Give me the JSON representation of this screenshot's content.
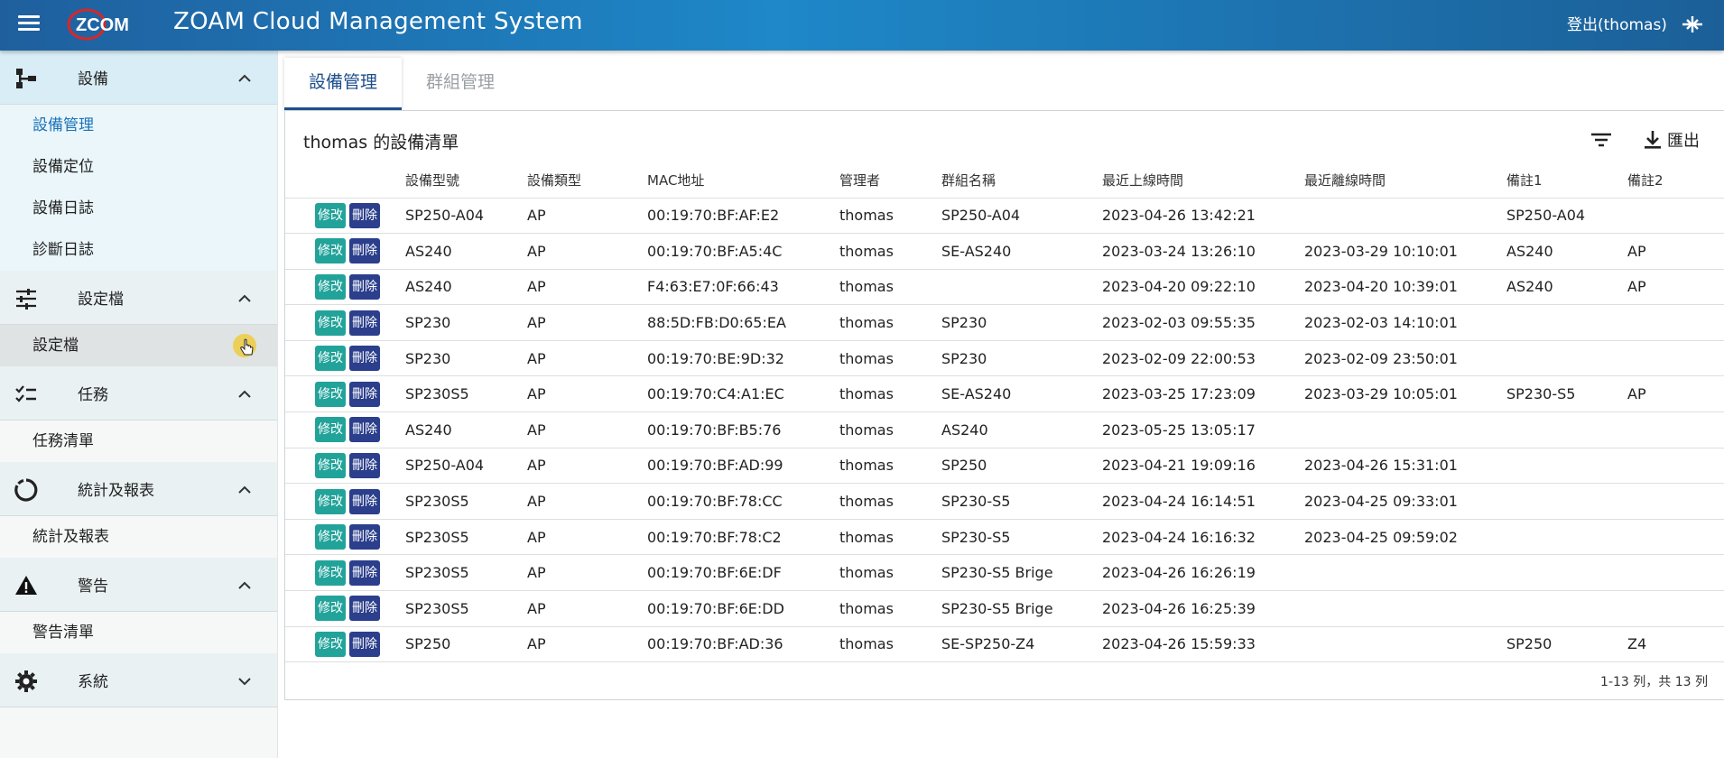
{
  "header": {
    "logo_text": "ZCOM",
    "title": "ZOAM Cloud Management System",
    "logout_label": "登出(thomas)"
  },
  "sidebar": {
    "sections": [
      {
        "label": "設備",
        "icon": "device-tree-icon",
        "expanded": true,
        "items": [
          "設備管理",
          "設備定位",
          "設備日誌",
          "診斷日誌"
        ]
      },
      {
        "label": "設定檔",
        "icon": "sliders-icon",
        "expanded": true,
        "items": [
          "設定檔"
        ]
      },
      {
        "label": "任務",
        "icon": "checklist-icon",
        "expanded": true,
        "items": [
          "任務清單"
        ]
      },
      {
        "label": "統計及報表",
        "icon": "donut-chart-icon",
        "expanded": true,
        "items": [
          "統計及報表"
        ]
      },
      {
        "label": "警告",
        "icon": "warning-icon",
        "expanded": true,
        "items": [
          "警告清單"
        ]
      },
      {
        "label": "系統",
        "icon": "gear-icon",
        "expanded": false,
        "items": []
      }
    ],
    "active_item": "設備管理"
  },
  "tabs": [
    {
      "label": "設備管理",
      "active": true
    },
    {
      "label": "群組管理",
      "active": false
    }
  ],
  "panel": {
    "title": "thomas 的設備清單",
    "export_label": "匯出",
    "edit_label": "修改",
    "delete_label": "刪除",
    "columns": [
      "設備型號",
      "設備類型",
      "MAC地址",
      "管理者",
      "群組名稱",
      "最近上線時間",
      "最近離線時間",
      "備註1",
      "備註2"
    ],
    "rows": [
      [
        "SP250-A04",
        "AP",
        "00:19:70:BF:AF:E2",
        "thomas",
        "SP250-A04",
        "2023-04-26 13:42:21",
        "",
        "SP250-A04",
        ""
      ],
      [
        "AS240",
        "AP",
        "00:19:70:BF:A5:4C",
        "thomas",
        "SE-AS240",
        "2023-03-24 13:26:10",
        "2023-03-29 10:10:01",
        "AS240",
        "AP"
      ],
      [
        "AS240",
        "AP",
        "F4:63:E7:0F:66:43",
        "thomas",
        "",
        "2023-04-20 09:22:10",
        "2023-04-20 10:39:01",
        "AS240",
        "AP"
      ],
      [
        "SP230",
        "AP",
        "88:5D:FB:D0:65:EA",
        "thomas",
        "SP230",
        "2023-02-03 09:55:35",
        "2023-02-03 14:10:01",
        "",
        ""
      ],
      [
        "SP230",
        "AP",
        "00:19:70:BE:9D:32",
        "thomas",
        "SP230",
        "2023-02-09 22:00:53",
        "2023-02-09 23:50:01",
        "",
        ""
      ],
      [
        "SP230S5",
        "AP",
        "00:19:70:C4:A1:EC",
        "thomas",
        "SE-AS240",
        "2023-03-25 17:23:09",
        "2023-03-29 10:05:01",
        "SP230-S5",
        "AP"
      ],
      [
        "AS240",
        "AP",
        "00:19:70:BF:B5:76",
        "thomas",
        "AS240",
        "2023-05-25 13:05:17",
        "",
        "",
        ""
      ],
      [
        "SP250-A04",
        "AP",
        "00:19:70:BF:AD:99",
        "thomas",
        "SP250",
        "2023-04-21 19:09:16",
        "2023-04-26 15:31:01",
        "",
        ""
      ],
      [
        "SP230S5",
        "AP",
        "00:19:70:BF:78:CC",
        "thomas",
        "SP230-S5",
        "2023-04-24 16:14:51",
        "2023-04-25 09:33:01",
        "",
        ""
      ],
      [
        "SP230S5",
        "AP",
        "00:19:70:BF:78:C2",
        "thomas",
        "SP230-S5",
        "2023-04-24 16:16:32",
        "2023-04-25 09:59:02",
        "",
        ""
      ],
      [
        "SP230S5",
        "AP",
        "00:19:70:BF:6E:DF",
        "thomas",
        "SP230-S5 Brige",
        "2023-04-26 16:26:19",
        "",
        "",
        ""
      ],
      [
        "SP230S5",
        "AP",
        "00:19:70:BF:6E:DD",
        "thomas",
        "SP230-S5 Brige",
        "2023-04-26 16:25:39",
        "",
        "",
        ""
      ],
      [
        "SP250",
        "AP",
        "00:19:70:BF:AD:36",
        "thomas",
        "SE-SP250-Z4",
        "2023-04-26 15:59:33",
        "",
        "SP250",
        "Z4"
      ]
    ],
    "pagination": "1-13 列，共 13 列"
  },
  "colors": {
    "header_start": "#1f5f9e",
    "header_mid": "#1e88c8",
    "active_link": "#1b73b8",
    "tab_active": "#1d4f8c",
    "edit_button": "#22a39a",
    "delete_button": "#2b3f8c"
  }
}
